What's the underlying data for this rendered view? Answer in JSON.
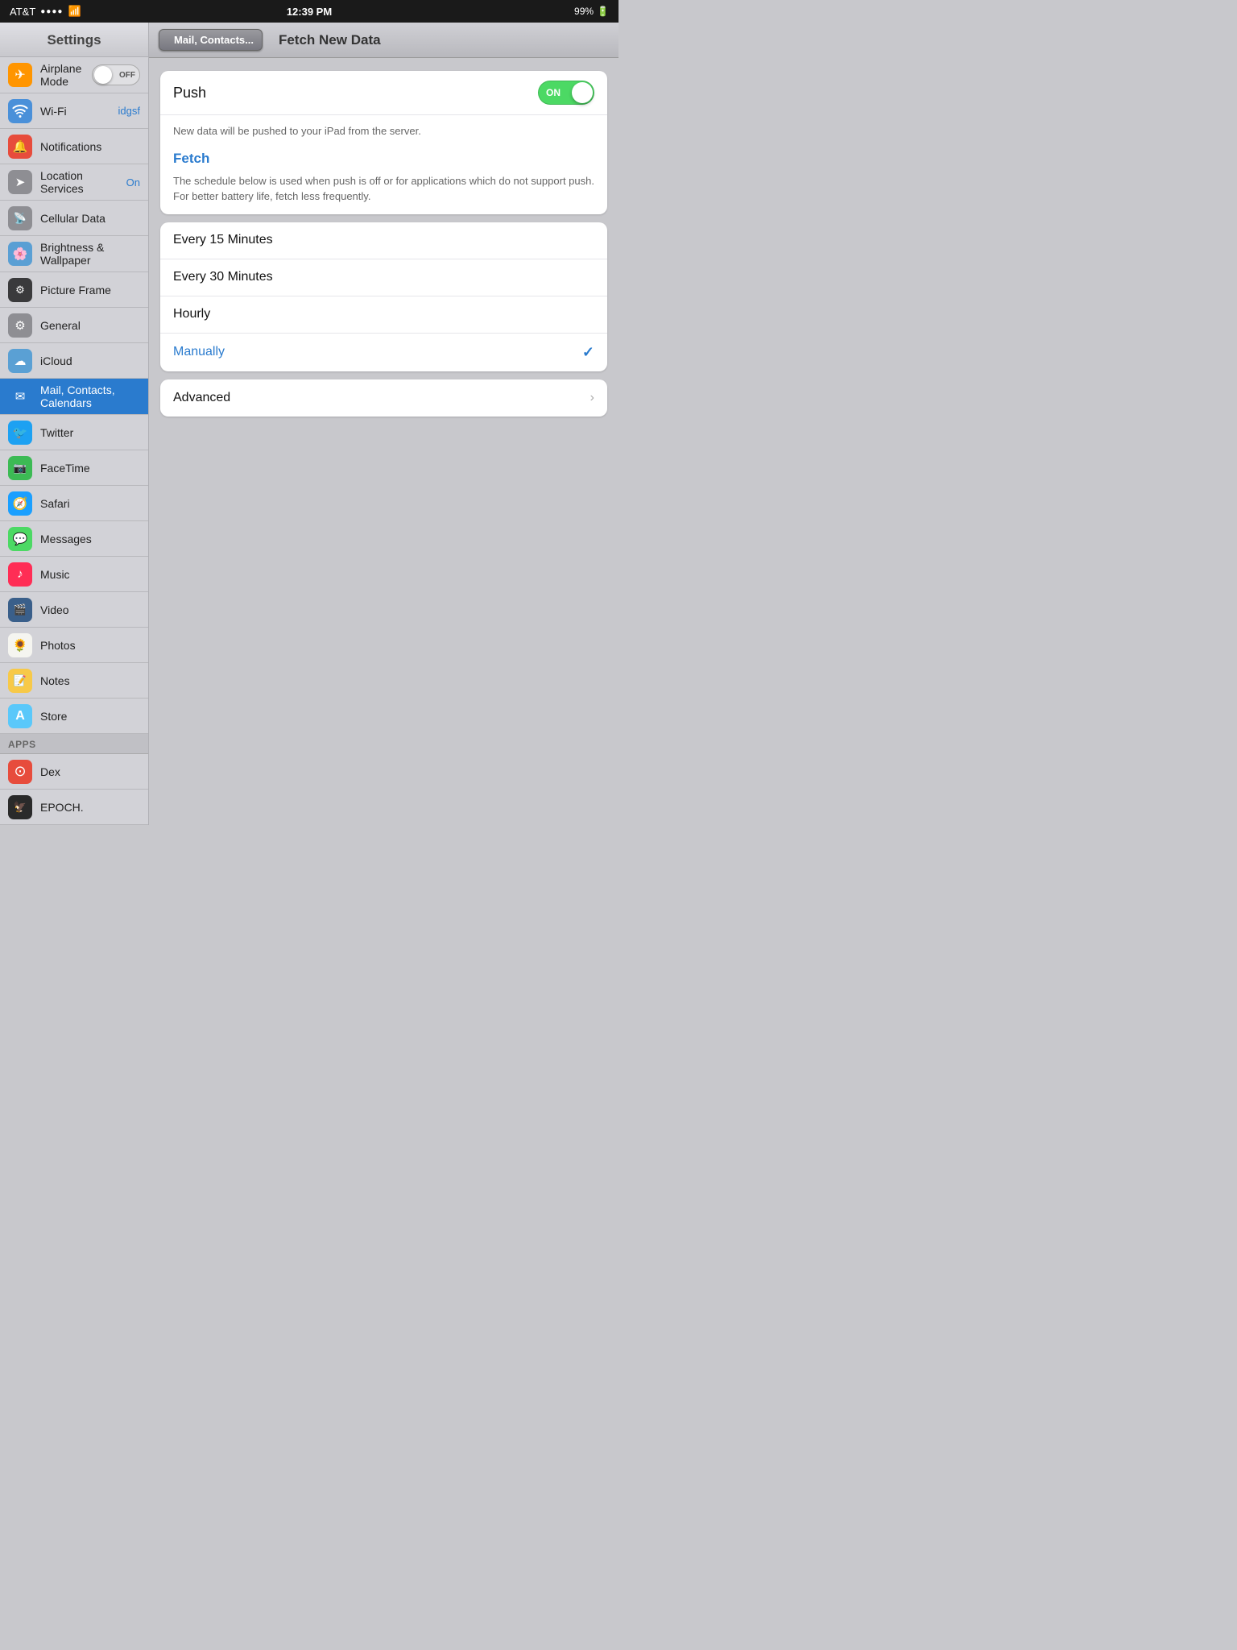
{
  "statusBar": {
    "carrier": "AT&T",
    "signal": "....",
    "wifi": "wifi",
    "time": "12:39 PM",
    "battery": "99%"
  },
  "sidebar": {
    "title": "Settings",
    "items": [
      {
        "id": "airplane-mode",
        "label": "Airplane Mode",
        "icon": "✈",
        "iconClass": "icon-airplane",
        "value": "",
        "hasToggle": true,
        "toggleState": "OFF"
      },
      {
        "id": "wifi",
        "label": "Wi-Fi",
        "icon": "📶",
        "iconClass": "icon-wifi",
        "value": "idgsf",
        "hasToggle": false
      },
      {
        "id": "notifications",
        "label": "Notifications",
        "icon": "🔔",
        "iconClass": "icon-notif",
        "value": "",
        "hasToggle": false
      },
      {
        "id": "location-services",
        "label": "Location Services",
        "icon": "📍",
        "iconClass": "icon-location",
        "value": "On",
        "hasToggle": false
      },
      {
        "id": "cellular-data",
        "label": "Cellular Data",
        "icon": "📡",
        "iconClass": "icon-cell",
        "value": "",
        "hasToggle": false
      },
      {
        "id": "brightness-wallpaper",
        "label": "Brightness & Wallpaper",
        "icon": "☀",
        "iconClass": "icon-brightness",
        "value": "",
        "hasToggle": false
      },
      {
        "id": "picture-frame",
        "label": "Picture Frame",
        "icon": "🖼",
        "iconClass": "icon-picture",
        "value": "",
        "hasToggle": false
      },
      {
        "id": "general",
        "label": "General",
        "icon": "⚙",
        "iconClass": "icon-general",
        "value": "",
        "hasToggle": false
      },
      {
        "id": "icloud",
        "label": "iCloud",
        "icon": "☁",
        "iconClass": "icon-icloud",
        "value": "",
        "hasToggle": false
      },
      {
        "id": "mail-contacts-calendars",
        "label": "Mail, Contacts, Calendars",
        "icon": "✉",
        "iconClass": "icon-mail",
        "value": "",
        "active": true,
        "hasToggle": false
      },
      {
        "id": "twitter",
        "label": "Twitter",
        "icon": "🐦",
        "iconClass": "icon-twitter",
        "value": "",
        "hasToggle": false
      },
      {
        "id": "facetime",
        "label": "FaceTime",
        "icon": "📷",
        "iconClass": "icon-facetime",
        "value": "",
        "hasToggle": false
      },
      {
        "id": "safari",
        "label": "Safari",
        "icon": "🧭",
        "iconClass": "icon-safari",
        "value": "",
        "hasToggle": false
      },
      {
        "id": "messages",
        "label": "Messages",
        "icon": "💬",
        "iconClass": "icon-messages",
        "value": "",
        "hasToggle": false
      },
      {
        "id": "music",
        "label": "Music",
        "icon": "♪",
        "iconClass": "icon-music",
        "value": "",
        "hasToggle": false
      },
      {
        "id": "video",
        "label": "Video",
        "icon": "🎬",
        "iconClass": "icon-video",
        "value": "",
        "hasToggle": false
      },
      {
        "id": "photos",
        "label": "Photos",
        "icon": "🌻",
        "iconClass": "icon-photos",
        "value": "",
        "hasToggle": false
      },
      {
        "id": "notes",
        "label": "Notes",
        "icon": "📝",
        "iconClass": "icon-notes",
        "value": "",
        "hasToggle": false
      },
      {
        "id": "store",
        "label": "Store",
        "icon": "A",
        "iconClass": "icon-store",
        "value": "",
        "hasToggle": false
      }
    ],
    "appsSection": {
      "header": "Apps",
      "items": [
        {
          "id": "dex",
          "label": "Dex",
          "icon": "⊙",
          "iconClass": "icon-dex"
        },
        {
          "id": "epoch",
          "label": "EPOCH.",
          "icon": "🦅",
          "iconClass": "icon-epoch"
        }
      ]
    }
  },
  "navBar": {
    "backButton": "Mail, Contacts...",
    "title": "Fetch New Data"
  },
  "fetchNewData": {
    "pushLabel": "Push",
    "pushState": "ON",
    "pushDescription": "New data will be pushed to your iPad from the server.",
    "fetchHeading": "Fetch",
    "fetchDescription": "The schedule below is used when push is off or for applications which do not support push. For better battery life, fetch less frequently.",
    "options": [
      {
        "id": "every-15",
        "label": "Every 15 Minutes",
        "selected": false
      },
      {
        "id": "every-30",
        "label": "Every 30 Minutes",
        "selected": false
      },
      {
        "id": "hourly",
        "label": "Hourly",
        "selected": false
      },
      {
        "id": "manually",
        "label": "Manually",
        "selected": true
      }
    ],
    "advancedLabel": "Advanced"
  }
}
